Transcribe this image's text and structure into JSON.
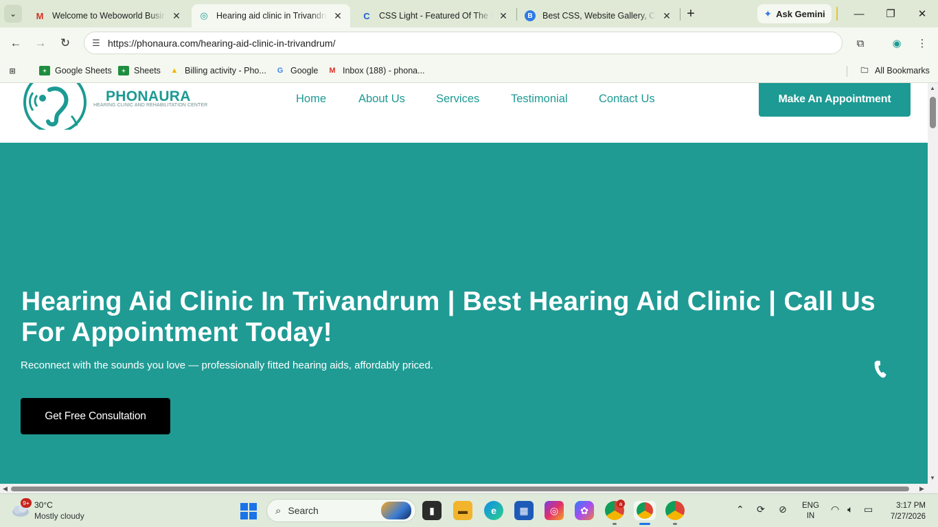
{
  "browser": {
    "tabs": [
      {
        "title": "Welcome to Weboworld Business",
        "favicon": "gmail-icon",
        "active": false
      },
      {
        "title": "Hearing aid clinic in Trivandrum",
        "favicon": "phonaura-icon",
        "active": true
      },
      {
        "title": "CSS Light - Featured Of The Day",
        "favicon": "csslight-icon",
        "active": false
      },
      {
        "title": "Best CSS, Website Gallery, CSS Gallery",
        "favicon": "bestcss-icon",
        "active": false
      }
    ],
    "ask_gemini": "Ask Gemini",
    "url": "https://phonaura.com/hearing-aid-clinic-in-trivandrum/",
    "bookmarks": [
      {
        "label": "Google Sheets",
        "icon": "sheets-plus-icon"
      },
      {
        "label": "Sheets",
        "icon": "sheets-plus-icon"
      },
      {
        "label": "Billing activity - Pho...",
        "icon": "google-ads-icon"
      },
      {
        "label": "Google",
        "icon": "google-icon"
      },
      {
        "label": "Inbox (188) - phona...",
        "icon": "gmail-icon"
      }
    ],
    "all_bookmarks": "All Bookmarks"
  },
  "site": {
    "brand": {
      "name": "PHONAURA",
      "tagline": "HEARING CLINIC AND REHABILITATION CENTER"
    },
    "nav": [
      {
        "label": "Home"
      },
      {
        "label": "About Us"
      },
      {
        "label": "Services"
      },
      {
        "label": "Testimonial"
      },
      {
        "label": "Contact Us"
      }
    ],
    "appointment_button": "Make An Appointment",
    "hero": {
      "heading": "Hearing Aid Clinic In Trivandrum | Best Hearing Aid Clinic | Call Us For Appointment Today!",
      "subtext": "Reconnect with the sounds you love — professionally fitted hearing aids, affordably priced.",
      "cta": "Get Free Consultation"
    },
    "colors": {
      "brand_teal": "#1c9a93",
      "hero_bg": "#1f9b94",
      "cta_bg": "#000000"
    }
  },
  "taskbar": {
    "weather": {
      "temp": "30°C",
      "condition": "Mostly cloudy",
      "badge": "9+"
    },
    "search_placeholder": "Search",
    "language": {
      "line1": "ENG",
      "line2": "IN"
    },
    "clock": {
      "time": "3:17 PM",
      "date": "7/27/2026"
    },
    "chrome_badge": "a"
  }
}
